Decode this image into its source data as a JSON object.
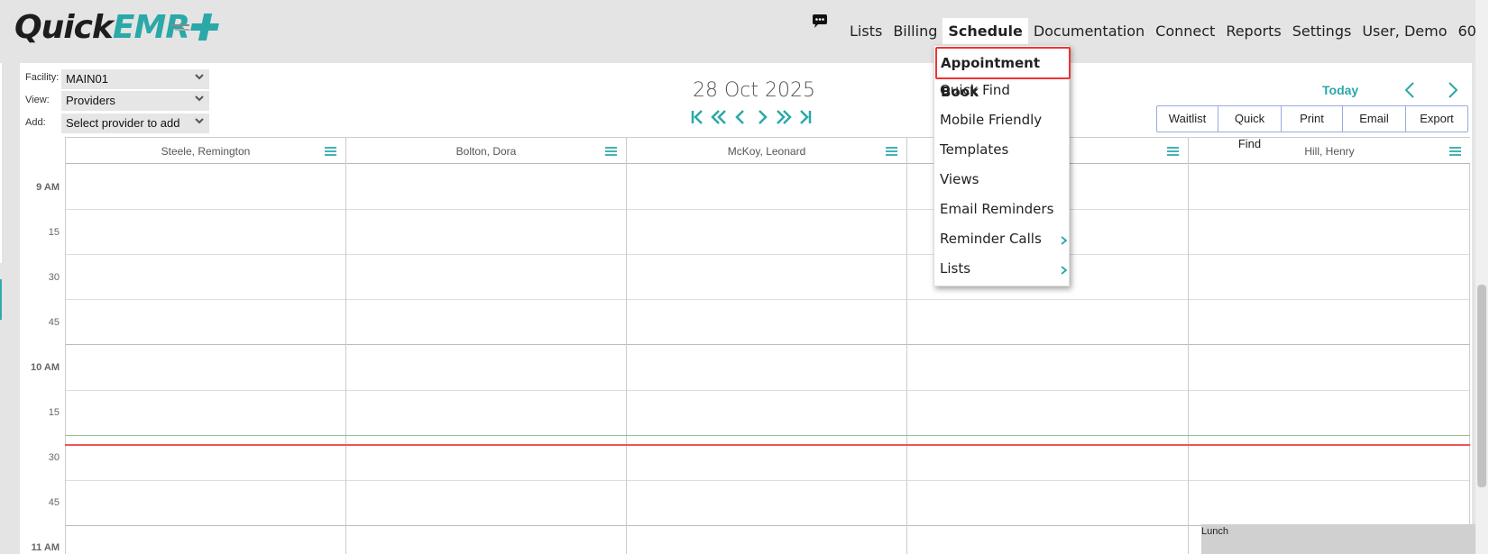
{
  "header": {
    "logo_part1": "Quick",
    "logo_part2": "EMR",
    "nav": [
      "Lists",
      "Billing",
      "Schedule",
      "Documentation",
      "Connect",
      "Reports",
      "Settings",
      "User, Demo",
      "60"
    ]
  },
  "controls": {
    "facility_label": "Facility:",
    "facility_value": "MAIN01",
    "view_label": "View:",
    "view_value": "Providers",
    "add_label": "Add:",
    "add_value": "Select provider to add"
  },
  "schedule": {
    "date": "28 Oct 2025",
    "today_label": "Today",
    "buttons": [
      "Waitlist",
      "Quick Find",
      "Print",
      "Email",
      "Export"
    ],
    "providers": [
      "Steele, Remington",
      "Bolton, Dora",
      "McKoy, Leonard",
      "",
      "Hill, Henry"
    ],
    "time_labels": [
      "9 AM",
      "15",
      "30",
      "45",
      "10 AM",
      "15",
      "30",
      "45",
      "11 AM"
    ],
    "lunch_label": "Lunch"
  },
  "schedule_menu": {
    "items": [
      "Appointment Book",
      "Quick Find",
      "Mobile Friendly",
      "Templates",
      "Views",
      "Email Reminders",
      "Reminder Calls",
      "Lists"
    ]
  },
  "colors": {
    "accent": "#2ba8a8",
    "highlight_border": "#e33333",
    "now_line": "#ee5555"
  }
}
